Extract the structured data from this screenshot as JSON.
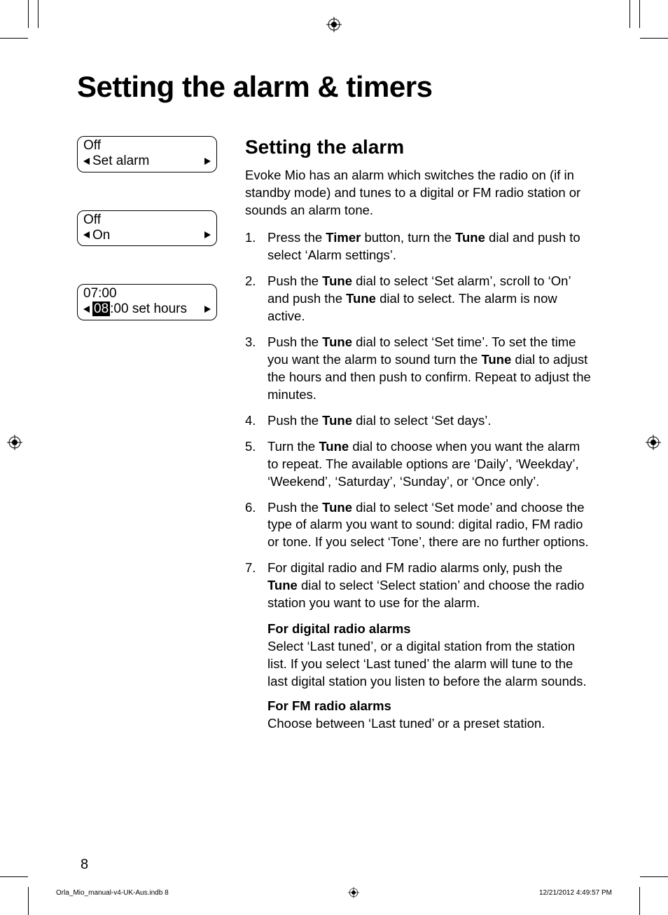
{
  "title": "Setting the alarm & timers",
  "lcd": [
    {
      "line1": "Off",
      "line2": "Set alarm",
      "highlight": null
    },
    {
      "line1": "Off",
      "line2": "On",
      "highlight": null
    },
    {
      "line1": "07:00",
      "line2_pre_hl": "08",
      "line2_post_hl": ":00 set hours"
    }
  ],
  "section_heading": "Setting the alarm",
  "intro": "Evoke Mio has an alarm which switches the radio on (if in standby mode) and tunes to a digital or FM radio station or sounds an alarm tone.",
  "steps": [
    {
      "pre": "Press the ",
      "b1": "Timer",
      "mid": " button, turn the ",
      "b2": "Tune",
      "post": " dial and push to select ‘Alarm settings’."
    },
    {
      "pre": "Push the ",
      "b1": "Tune",
      "mid": " dial to select ‘Set alarm’, scroll to ‘On’ and push the ",
      "b2": "Tune",
      "post": " dial to select. The alarm is now active."
    },
    {
      "pre": "Push the ",
      "b1": "Tune",
      "mid": " dial to select ‘Set time’. To set the time you want the alarm to sound turn the ",
      "b2": "Tune",
      "post": " dial to adjust the hours and then push to confirm. Repeat to adjust the minutes."
    },
    {
      "pre": "Push the ",
      "b1": "Tune",
      "mid": " dial to select ‘Set days’.",
      "b2": "",
      "post": ""
    },
    {
      "pre": "Turn the ",
      "b1": "Tune",
      "mid": " dial to choose when you want the alarm to repeat. The available options are ‘Daily’, ‘Weekday’, ‘Weekend’, ‘Saturday’, ‘Sunday’, or ‘Once only’.",
      "b2": "",
      "post": ""
    },
    {
      "pre": "Push the ",
      "b1": "Tune",
      "mid": " dial to select ‘Set mode’ and choose the type of alarm you want to sound: digital radio, FM radio or tone. If you select ‘Tone’, there are no further options.",
      "b2": "",
      "post": ""
    },
    {
      "pre": "For digital radio and FM radio alarms only, push the ",
      "b1": "Tune",
      "mid": " dial to select ‘Select station’ and choose the radio station you want to use for the alarm.",
      "b2": "",
      "post": ""
    }
  ],
  "sub1_head": "For digital radio alarms",
  "sub1_body": "Select ‘Last tuned’, or a digital station from the station list. If you select ‘Last tuned’ the alarm will tune to the last digital station you listen to before the alarm sounds.",
  "sub2_head": "For FM radio alarms",
  "sub2_body": "Choose between ‘Last tuned’ or a preset station.",
  "page_number": "8",
  "footer_file": "Orla_Mio_manual-v4-UK-Aus.indb   8",
  "footer_date": "12/21/2012   4:49:57 PM"
}
